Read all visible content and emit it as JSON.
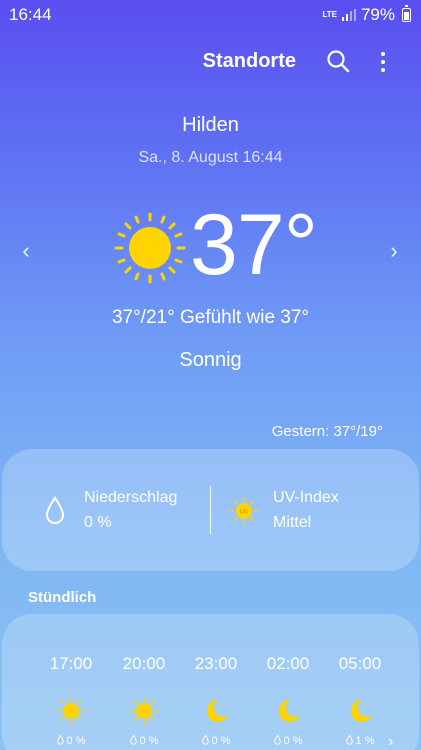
{
  "status_bar": {
    "time": "16:44",
    "network": "LTE",
    "battery": "79%"
  },
  "toolbar": {
    "title": "Standorte",
    "search_icon": "search-icon",
    "more_icon": "more-vert-icon"
  },
  "weather": {
    "city": "Hilden",
    "datetime": "Sa., 8. August 16:44",
    "temperature": "37°",
    "hilo_feels": "37°/21° Gefühlt wie 37°",
    "condition": "Sonnig",
    "yesterday": "Gestern: 37°/19°"
  },
  "details": {
    "precip_label": "Niederschlag",
    "precip_value": "0 %",
    "uv_label": "UV-Index",
    "uv_value": "Mittel"
  },
  "hourly": {
    "title": "Stündlich",
    "items": [
      {
        "time": "17:00",
        "icon": "sun-icon",
        "precip": "0 %"
      },
      {
        "time": "20:00",
        "icon": "sun-icon",
        "precip": "0 %"
      },
      {
        "time": "23:00",
        "icon": "moon-icon",
        "precip": "0 %"
      },
      {
        "time": "02:00",
        "icon": "moon-icon",
        "precip": "0 %"
      },
      {
        "time": "05:00",
        "icon": "moon-icon",
        "precip": "1 %"
      }
    ]
  },
  "colors": {
    "gradient_top": "#5a4ef0",
    "gradient_bottom": "#8cc2f2",
    "sun": "#ffd400"
  }
}
